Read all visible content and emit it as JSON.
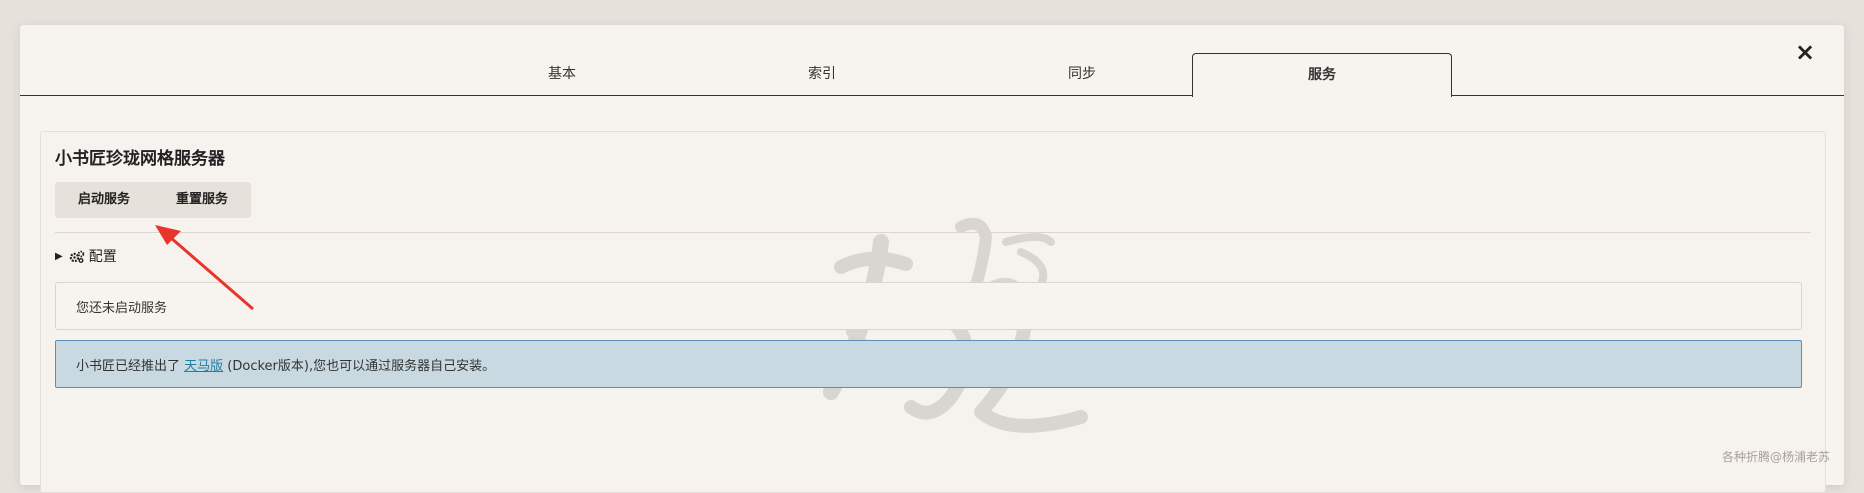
{
  "dialog": {
    "close_icon": "×",
    "tabs": [
      {
        "label": "基本"
      },
      {
        "label": "索引"
      },
      {
        "label": "同步"
      },
      {
        "label": "服务",
        "active": true
      }
    ]
  },
  "panel": {
    "title": "小书匠珍珑网格服务器",
    "buttons": {
      "start": "启动服务",
      "reset": "重置服务"
    },
    "config_label": "配置",
    "status_text": "您还未启动服务",
    "info": {
      "prefix": "小书匠已经推出了 ",
      "link": "天马版",
      "suffix": " (Docker版本),您也可以通过服务器自己安装。"
    }
  },
  "watermark_corner": "各种折腾@杨浦老苏",
  "colors": {
    "background": "#e6e1db",
    "dialog": "#f7f3ee",
    "info_bg": "#c8d9e1",
    "info_border": "#5b8fb6",
    "link": "#1f7fa3",
    "annotation_arrow": "#e8342a"
  }
}
